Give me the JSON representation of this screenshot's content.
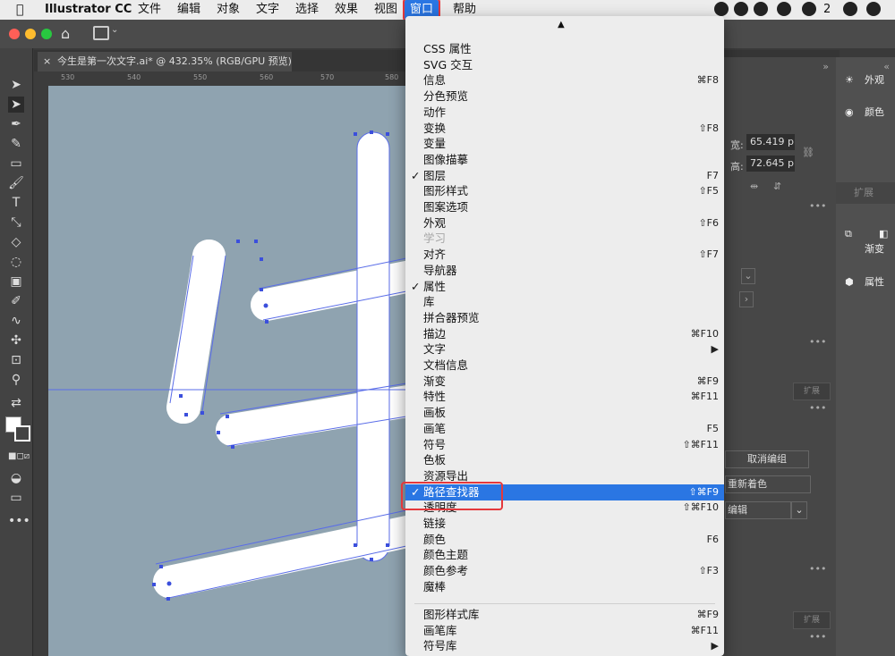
{
  "menubar": {
    "app": "Illustrator CC",
    "items": [
      "文件",
      "编辑",
      "对象",
      "文字",
      "选择",
      "效果",
      "视图",
      "窗口",
      "帮助"
    ],
    "active": "窗口",
    "status_count": "2"
  },
  "doc_tab": {
    "title": "今生是第一次文字.ai* @ 432.35% (RGB/GPU 预览)"
  },
  "rulers": {
    "h_ticks": [
      "530",
      "540",
      "550",
      "560",
      "570",
      "580"
    ]
  },
  "props_panel": {
    "width_label": "宽:",
    "width_value": "65.419 p",
    "height_label": "高:",
    "height_value": "72.645 p",
    "expand": "扩展",
    "ungroup": "取消编组",
    "recolor": "重新着色",
    "edit": "编辑",
    "expand2": "扩展",
    "expand3": "扩展"
  },
  "dock": {
    "items": [
      "外观",
      "颜色",
      "",
      "渐变",
      "属性"
    ]
  },
  "window_menu": {
    "scroll_up": "▲",
    "highlight_color": "#2a76e3",
    "items": [
      {
        "label": "CSS 属性",
        "shortcut": "",
        "checked": false
      },
      {
        "label": "SVG 交互",
        "shortcut": "",
        "checked": false
      },
      {
        "label": "信息",
        "shortcut": "⌘F8",
        "checked": false
      },
      {
        "label": "分色预览",
        "shortcut": "",
        "checked": false
      },
      {
        "label": "动作",
        "shortcut": "",
        "checked": false
      },
      {
        "label": "变换",
        "shortcut": "⇧F8",
        "checked": false
      },
      {
        "label": "变量",
        "shortcut": "",
        "checked": false
      },
      {
        "label": "图像描摹",
        "shortcut": "",
        "checked": false
      },
      {
        "label": "图层",
        "shortcut": "F7",
        "checked": true
      },
      {
        "label": "图形样式",
        "shortcut": "⇧F5",
        "checked": false
      },
      {
        "label": "图案选项",
        "shortcut": "",
        "checked": false
      },
      {
        "label": "外观",
        "shortcut": "⇧F6",
        "checked": false
      },
      {
        "label": "学习",
        "shortcut": "",
        "checked": false,
        "disabled": true
      },
      {
        "label": "对齐",
        "shortcut": "⇧F7",
        "checked": false
      },
      {
        "label": "导航器",
        "shortcut": "",
        "checked": false
      },
      {
        "label": "属性",
        "shortcut": "",
        "checked": true
      },
      {
        "label": "库",
        "shortcut": "",
        "checked": false
      },
      {
        "label": "拼合器预览",
        "shortcut": "",
        "checked": false
      },
      {
        "label": "描边",
        "shortcut": "⌘F10",
        "checked": false
      },
      {
        "label": "文字",
        "shortcut": "▶",
        "checked": false
      },
      {
        "label": "文档信息",
        "shortcut": "",
        "checked": false
      },
      {
        "label": "渐变",
        "shortcut": "⌘F9",
        "checked": false
      },
      {
        "label": "特性",
        "shortcut": "⌘F11",
        "checked": false
      },
      {
        "label": "画板",
        "shortcut": "",
        "checked": false
      },
      {
        "label": "画笔",
        "shortcut": "F5",
        "checked": false
      },
      {
        "label": "符号",
        "shortcut": "⇧⌘F11",
        "checked": false
      },
      {
        "label": "色板",
        "shortcut": "",
        "checked": false
      },
      {
        "label": "资源导出",
        "shortcut": "",
        "checked": false
      },
      {
        "label": "路径查找器",
        "shortcut": "⇧⌘F9",
        "checked": true,
        "highlighted": true
      },
      {
        "label": "透明度",
        "shortcut": "⇧⌘F10",
        "checked": false
      },
      {
        "label": "链接",
        "shortcut": "",
        "checked": false
      },
      {
        "label": "颜色",
        "shortcut": "F6",
        "checked": false
      },
      {
        "label": "颜色主题",
        "shortcut": "",
        "checked": false
      },
      {
        "label": "颜色参考",
        "shortcut": "⇧F3",
        "checked": false
      },
      {
        "label": "魔棒",
        "shortcut": "",
        "checked": false
      }
    ],
    "library_items": [
      {
        "label": "图形样式库",
        "shortcut": "⌘F9"
      },
      {
        "label": "画笔库",
        "shortcut": "⌘F11"
      },
      {
        "label": "符号库",
        "shortcut": "▶"
      }
    ]
  }
}
